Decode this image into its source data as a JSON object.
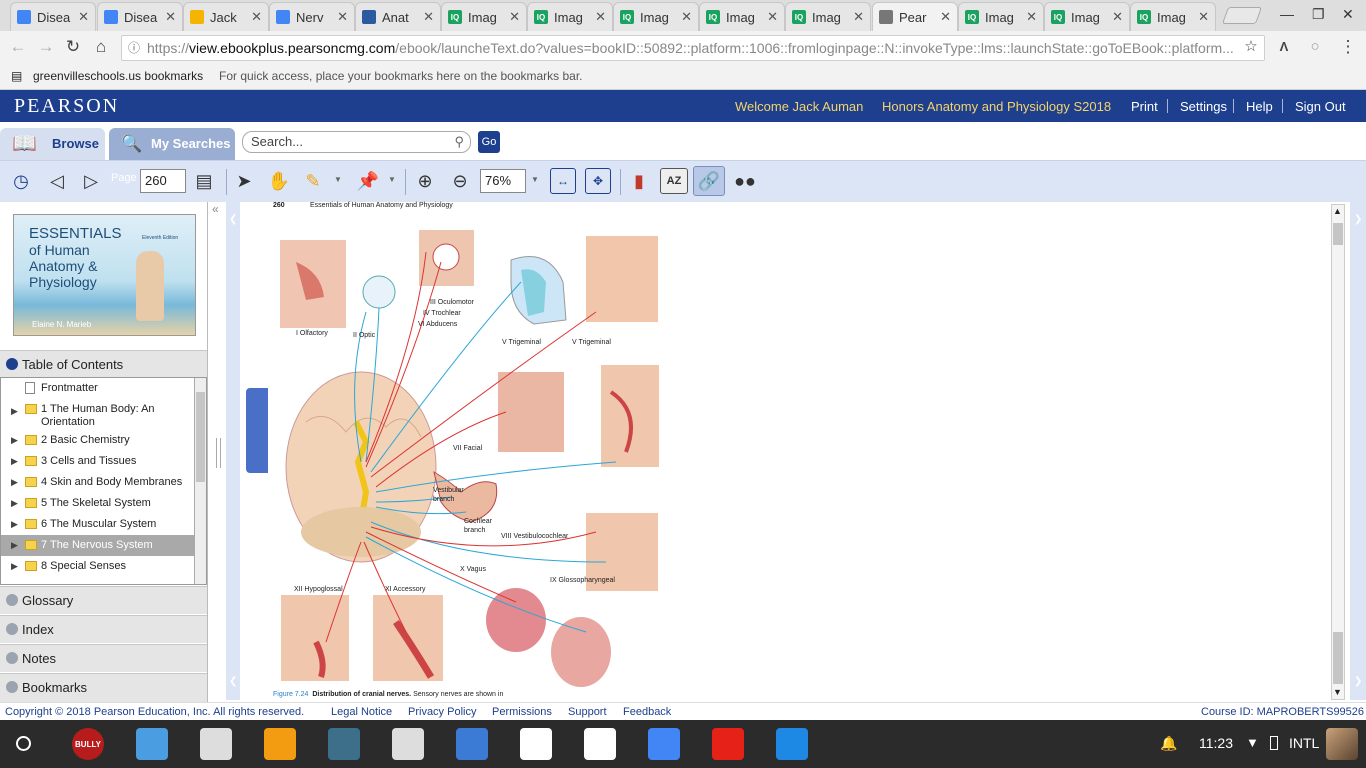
{
  "browser": {
    "tabs": [
      {
        "title": "Disea",
        "icon": "docs-icon",
        "color": "#4285f4"
      },
      {
        "title": "Disea",
        "icon": "docs-icon",
        "color": "#4285f4"
      },
      {
        "title": "Jack",
        "icon": "slides-icon",
        "color": "#f4b400"
      },
      {
        "title": "Nerv",
        "icon": "docs-icon",
        "color": "#4285f4"
      },
      {
        "title": "Anat",
        "icon": "classroom-icon",
        "color": "#2c5aa0"
      },
      {
        "title": "Imag",
        "icon": "iq-icon",
        "color": "#1aa260"
      },
      {
        "title": "Imag",
        "icon": "iq-icon",
        "color": "#1aa260"
      },
      {
        "title": "Imag",
        "icon": "iq-icon",
        "color": "#1aa260"
      },
      {
        "title": "Imag",
        "icon": "iq-icon",
        "color": "#1aa260"
      },
      {
        "title": "Imag",
        "icon": "iq-icon",
        "color": "#1aa260"
      },
      {
        "title": "Pear",
        "icon": "page-icon",
        "color": "#777777"
      },
      {
        "title": "Imag",
        "icon": "iq-icon",
        "color": "#1aa260"
      },
      {
        "title": "Imag",
        "icon": "iq-icon",
        "color": "#1aa260"
      },
      {
        "title": "Imag",
        "icon": "iq-icon",
        "color": "#1aa260"
      }
    ],
    "url_prefix": "https://",
    "url_domain": "view.ebookplus.pearsoncmg.com",
    "url_rest": "/ebook/launcheText.do?values=bookID::50892::platform::1006::fromloginpage::N::invokeType::lms::launchState::goToEBook::platform...",
    "bookmarks_folder": "greenvilleschools.us bookmarks",
    "bookmarks_hint": "For quick access, place your bookmarks here on the bookmarks bar."
  },
  "header": {
    "logo": "PEARSON",
    "welcome": "Welcome Jack Auman",
    "course": "Honors Anatomy and Physiology S2018",
    "links": [
      "Print",
      "Settings",
      "Help",
      "Sign Out"
    ]
  },
  "nav": {
    "browse": "Browse",
    "my_searches": "My Searches",
    "search_placeholder": "Search...",
    "go": "Go"
  },
  "toolbar": {
    "page_label": "Page",
    "page_value": "260",
    "zoom_value": "76%"
  },
  "sidebar": {
    "cover": {
      "title_line1": "ESSENTIALS",
      "title_line2": "of Human",
      "title_line3": "Anatomy &",
      "title_line4": "Physiology",
      "edition": "Eleventh Edition",
      "author": "Elaine N. Marieb"
    },
    "toc_header": "Table of Contents",
    "toc_items": [
      {
        "label": "Frontmatter",
        "type": "page"
      },
      {
        "label": "1 The Human Body: An",
        "label2": "Orientation",
        "type": "folder"
      },
      {
        "label": "2 Basic Chemistry",
        "type": "folder"
      },
      {
        "label": "3 Cells and Tissues",
        "type": "folder"
      },
      {
        "label": "4 Skin and Body Membranes",
        "type": "folder"
      },
      {
        "label": "5 The Skeletal System",
        "type": "folder"
      },
      {
        "label": "6 The Muscular System",
        "type": "folder"
      },
      {
        "label": "7 The Nervous System",
        "type": "folder",
        "selected": true
      },
      {
        "label": "8 Special Senses",
        "type": "folder"
      }
    ],
    "sections": [
      "Glossary",
      "Index",
      "Notes",
      "Bookmarks"
    ]
  },
  "page": {
    "number": "260",
    "running_head": "Essentials of Human Anatomy and Physiology",
    "labels": {
      "olfactory": "I Olfactory",
      "optic": "II Optic",
      "oculomotor": "III Oculomotor",
      "trochlear": "IV Trochlear",
      "abducens": "VI Abducens",
      "trigeminal1": "V Trigeminal",
      "trigeminal2": "V Trigeminal",
      "facial": "VII Facial",
      "vestibular1": "Vestibular",
      "vestibular2": "branch",
      "cochlear1": "Cochlear",
      "cochlear2": "branch",
      "vestibulocochlear": "VIII Vestibulocochlear",
      "vagus": "X Vagus",
      "glossopharyngeal": "IX Glossopharyngeal",
      "hypoglossal": "XII Hypoglossal",
      "accessory": "XI Accessory"
    },
    "caption_num": "Figure 7.24",
    "caption_title": "Distribution of cranial nerves.",
    "caption_text": "Sensory nerves are shown in"
  },
  "footer": {
    "copyright": "Copyright © 2018 Pearson Education, Inc. All rights reserved.",
    "links": [
      "Legal Notice",
      "Privacy Policy",
      "Permissions",
      "Support",
      "Feedback"
    ],
    "course_id": "Course ID: MAPROBERTS99526"
  },
  "taskbar": {
    "apps": [
      {
        "name": "bully-app-icon",
        "label": "BULLY",
        "color": "#b71c1c"
      },
      {
        "name": "keep-app-icon",
        "label": "",
        "color": "#4a9de0"
      },
      {
        "name": "tab-app-icon",
        "label": "",
        "color": "#dddddd"
      },
      {
        "name": "photo-app-icon",
        "label": "",
        "color": "#f39c12"
      },
      {
        "name": "security-app-icon",
        "label": "",
        "color": "#3e6f8a"
      },
      {
        "name": "tree-app-icon",
        "label": "",
        "color": "#dddddd"
      },
      {
        "name": "screen-app-icon",
        "label": "",
        "color": "#3b7bd6"
      },
      {
        "name": "chrome-app-icon",
        "label": "",
        "color": "#ffffff"
      },
      {
        "name": "gmail-app-icon",
        "label": "",
        "color": "#ffffff"
      },
      {
        "name": "docs-app-icon",
        "label": "",
        "color": "#4285f4"
      },
      {
        "name": "youtube-app-icon",
        "label": "",
        "color": "#e62117"
      },
      {
        "name": "canvas-app-icon",
        "label": "",
        "color": "#1e88e5"
      }
    ],
    "time": "11:23",
    "input_method": "INTL"
  }
}
